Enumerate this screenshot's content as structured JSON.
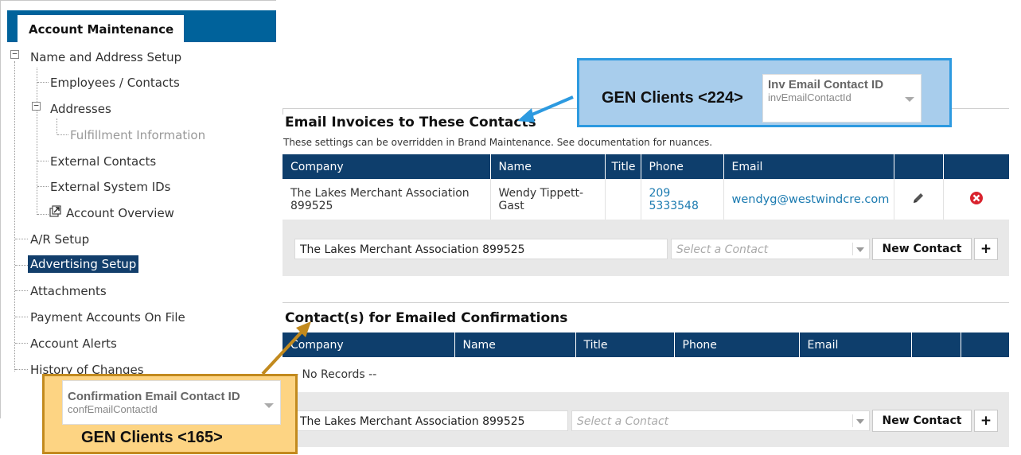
{
  "tree": {
    "tab_title": "Account Maintenance",
    "items": {
      "name_address": "Name and Address Setup",
      "employees": "Employees / Contacts",
      "addresses": "Addresses",
      "fulfillment": "Fulfillment Information",
      "external_contacts": "External Contacts",
      "external_ids": "External System IDs",
      "account_overview": "Account Overview",
      "ar_setup": "A/R Setup",
      "advertising_setup": "Advertising Setup",
      "attachments": "Attachments",
      "payment_accounts": "Payment Accounts On File",
      "account_alerts": "Account Alerts",
      "history": "History of Changes"
    }
  },
  "invoices": {
    "title": "Email Invoices to These Contacts",
    "note": "These settings can be overridden in Brand Maintenance. See documentation for nuances.",
    "headers": [
      "Company",
      "Name",
      "Title",
      "Phone",
      "Email",
      "",
      ""
    ],
    "row": {
      "company": "The Lakes Merchant Association 899525",
      "name": "Wendy Tippett-Gast",
      "title": "",
      "phone": "209 5333548",
      "email": "wendyg@westwindcre.com"
    },
    "company_field": "The Lakes Merchant Association 899525",
    "contact_placeholder": "Select a Contact",
    "new_contact": "New Contact",
    "add": "+"
  },
  "confirmations": {
    "title": "Contact(s) for Emailed Confirmations",
    "headers": [
      "Company",
      "Name",
      "Title",
      "Phone",
      "Email",
      "",
      ""
    ],
    "empty": "-- No Records --",
    "company_field": "The Lakes Merchant Association 899525",
    "contact_placeholder": "Select a Contact",
    "new_contact": "New Contact",
    "add": "+"
  },
  "callouts": {
    "blue": {
      "label": "GEN Clients <224>",
      "field_title": "Inv Email Contact ID",
      "field_sub": "invEmailContactId"
    },
    "gold": {
      "label": "GEN Clients <165>",
      "field_title": "Confirmation Email Contact ID",
      "field_sub": "confEmailContactId"
    }
  },
  "colors": {
    "header_bar": "#00629b",
    "table_header": "#0e3e6c",
    "selected_item": "#123e6b",
    "link": "#1a7ab0",
    "callout_blue_border": "#2d9ae0",
    "callout_gold_border": "#c28a1e",
    "delete_red": "#d9232e"
  },
  "icons": {
    "edit": "pencil-icon",
    "delete": "delete-circle-icon",
    "overview": "external-link-icon"
  }
}
